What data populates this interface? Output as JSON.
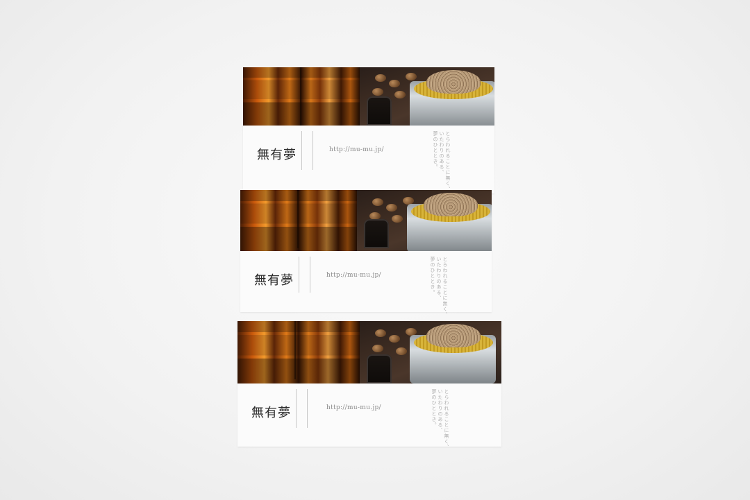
{
  "cards": [
    {
      "url": "http://mu-mu.jp/",
      "logo": "無有夢"
    },
    {
      "url": "http://mu-mu.jp/",
      "logo": "無有夢"
    },
    {
      "url": "http://mu-mu.jp/",
      "logo": "無有夢"
    }
  ],
  "poem_lines": [
    "とらわれることに無く、",
    "いたわりのある、",
    "夢のひととき。"
  ],
  "colors": {
    "background": "#f3f3f3",
    "card": "#fbfbfb",
    "interior_amber": "#e07a18"
  }
}
